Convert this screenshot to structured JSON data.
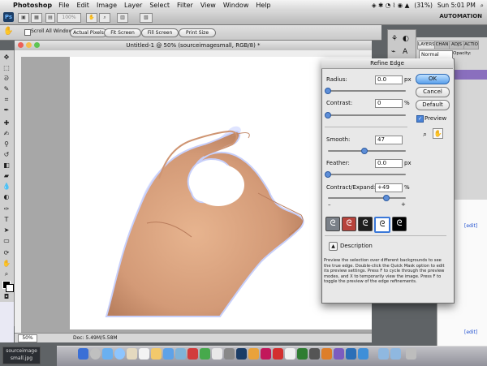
{
  "menubar": {
    "app_name": "Photoshop",
    "menus": [
      "File",
      "Edit",
      "Image",
      "Layer",
      "Select",
      "Filter",
      "View",
      "Window",
      "Help"
    ],
    "battery": "(31%)",
    "clock": "Sun 5:01 PM"
  },
  "appbar": {
    "logo": "Ps",
    "zoom": "100%",
    "workspace": "AUTOMATION"
  },
  "options": {
    "scroll_all_windows": "Scroll All Windows",
    "buttons": [
      "Actual Pixels",
      "Fit Screen",
      "Fill Screen",
      "Print Size"
    ]
  },
  "document": {
    "title": "Untitled-1 @ 50% (sourceimagesmall, RGB/8) *",
    "zoom": "50%",
    "doc_info": "Doc: 5.49M/5.58M"
  },
  "panels": {
    "tabs": [
      "LAYERS",
      "CHAN",
      "ADJS",
      "ACTIO"
    ],
    "blend_mode": "Normal",
    "opacity_label": "Opacity:",
    "edit_link": "[edit]"
  },
  "dialog": {
    "title": "Refine Edge",
    "radius": {
      "label": "Radius:",
      "value": "0.0",
      "unit": "px",
      "slider": 0.0
    },
    "contrast": {
      "label": "Contrast:",
      "value": "0",
      "unit": "%",
      "slider": 0.0
    },
    "smooth": {
      "label": "Smooth:",
      "value": "47",
      "slider": 0.47
    },
    "feather": {
      "label": "Feather:",
      "value": "0.0",
      "unit": "px",
      "slider": 0.0
    },
    "contract_expand": {
      "label": "Contract/Expand:",
      "value": "+49",
      "unit": "%",
      "slider": 0.745,
      "minus": "–",
      "plus": "+"
    },
    "preview_label": "Preview",
    "buttons": {
      "ok": "OK",
      "cancel": "Cancel",
      "default": "Default"
    },
    "description_label": "Description",
    "description_text": "Preview the selection over different backgrounds to see the true edge. Double-click the Quick Mask option to edit its preview settings. Press F to cycle through the preview modes, and X to temporarily view the image. Press F to toggle the preview of the edge refinements."
  },
  "desktop": {
    "file_label": "sourceimage small.jpg"
  },
  "colors": {
    "accent": "#5d8ed8",
    "dialog_bg": "#e8e8e8",
    "canvas": "#ffffff"
  }
}
